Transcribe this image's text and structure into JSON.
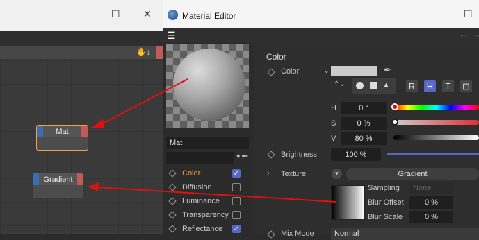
{
  "node_window": {
    "nodes": [
      {
        "label": "Mat"
      },
      {
        "label": "Gradient"
      }
    ]
  },
  "material_editor": {
    "title": "Material Editor",
    "menu_icon": "hamburger-icon",
    "material_name": "Mat",
    "channels": [
      {
        "name": "Color",
        "checked": true,
        "active": true
      },
      {
        "name": "Diffusion",
        "checked": false
      },
      {
        "name": "Luminance",
        "checked": false
      },
      {
        "name": "Transparency",
        "checked": false
      },
      {
        "name": "Reflectance",
        "checked": true
      }
    ],
    "section_title": "Color",
    "color_label": "Color",
    "mode_buttons": [
      "R",
      "H",
      "T"
    ],
    "h_label": "H",
    "h_value": "0 °",
    "s_label": "S",
    "s_value": "0 %",
    "v_label": "V",
    "v_value": "80 %",
    "brightness_label": "Brightness",
    "brightness_value": "100 %",
    "texture_label": "Texture",
    "texture_value": "Gradient",
    "sampling_label": "Sampling",
    "sampling_value": "None",
    "blur_offset_label": "Blur Offset",
    "blur_offset_value": "0 %",
    "blur_scale_label": "Blur Scale",
    "blur_scale_value": "0 %",
    "mix_mode_label": "Mix Mode",
    "mix_mode_value": "Normal",
    "colors": {
      "accent": "#5866c7",
      "arrow": "#e01010",
      "node_outline": "#e8a540"
    }
  }
}
